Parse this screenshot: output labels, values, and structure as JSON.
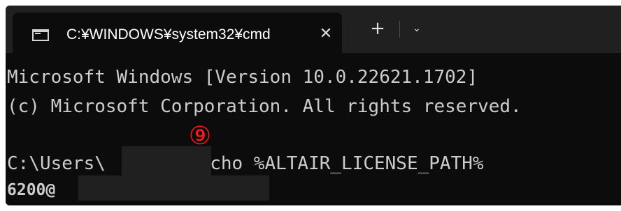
{
  "tab": {
    "title": "C:¥WINDOWS¥system32¥cmd",
    "close_glyph": "✕",
    "icon": "cmd-icon"
  },
  "toolbar": {
    "new_tab_glyph": "+",
    "dropdown_glyph": "⌄"
  },
  "console": {
    "line1": "Microsoft Windows [Version 10.0.22621.1702]",
    "line2": "(c) Microsoft Corporation. All rights reserved.",
    "line4_prefix": "C:\\Users\\",
    "line4_command": ">echo %ALTAIR_LICENSE_PATH%",
    "line5_prefix": "6200@"
  },
  "annotation": {
    "marker": "⑨",
    "color": "#ff1a1a"
  },
  "colors": {
    "background": "#0c0c0c",
    "titlebar": "#202020",
    "text": "#cccccc"
  }
}
